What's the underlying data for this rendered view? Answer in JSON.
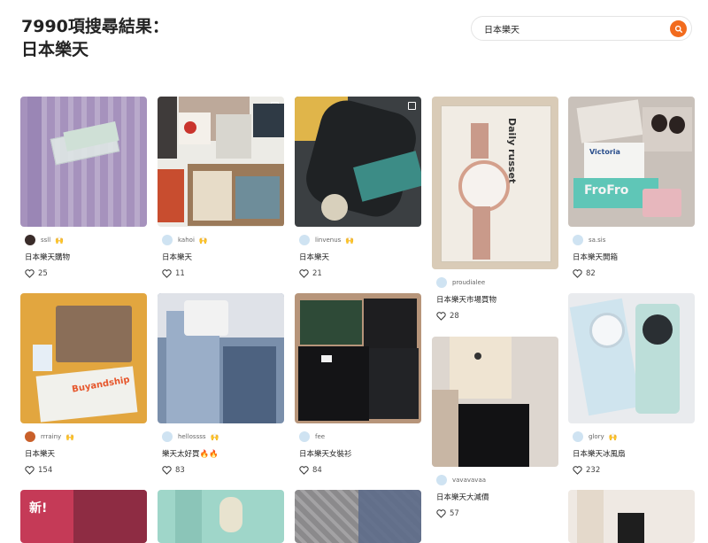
{
  "header": {
    "result_count": "7990項搜尋結果：",
    "query": "日本樂天"
  },
  "search": {
    "value": "日本樂天",
    "placeholder": ""
  },
  "colors": {
    "accent": "#f26b1d"
  },
  "cards": [
    {
      "user": "ssll",
      "title": "日本樂天購物",
      "likes": "25",
      "badge": "🙌"
    },
    {
      "user": "kahoi",
      "title": "日本樂天",
      "likes": "11",
      "badge": "🙌"
    },
    {
      "user": "linvenus",
      "title": "日本樂天",
      "likes": "21",
      "badge": "🙌"
    },
    {
      "user": "proudialee",
      "title": "日本樂天市場買物",
      "likes": "28",
      "badge": ""
    },
    {
      "user": "sa.sis",
      "title": "日本樂天開箱",
      "likes": "82",
      "badge": ""
    },
    {
      "user": "rrrainy",
      "title": "日本樂天",
      "likes": "154",
      "badge": "🙌"
    },
    {
      "user": "hellossss",
      "title": "樂天太好買🔥🔥",
      "likes": "83",
      "badge": "🙌"
    },
    {
      "user": "fee",
      "title": "日本樂天女裝衫",
      "likes": "84",
      "badge": ""
    },
    {
      "user": "vavavavaa",
      "title": "日本樂天大減價",
      "likes": "57",
      "badge": ""
    },
    {
      "user": "glory",
      "title": "日本樂天冰風扇",
      "likes": "232",
      "badge": "🙌"
    }
  ],
  "thumb_text": {
    "watch_box": "Daily russet",
    "bag": "Buyandship",
    "magazine": "新!",
    "frofro": "FroFro",
    "victoria": "Victoria"
  }
}
